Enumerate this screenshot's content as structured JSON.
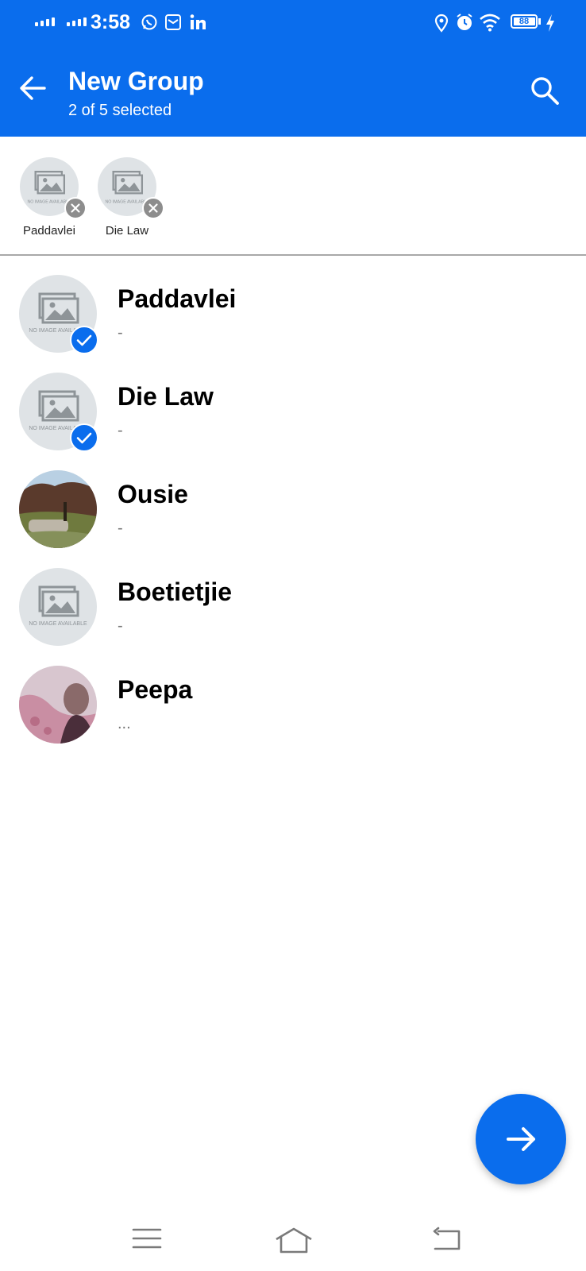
{
  "status_bar": {
    "time": "3:58",
    "battery": "88"
  },
  "header": {
    "title": "New Group",
    "subtitle": "2 of 5 selected"
  },
  "selected": [
    {
      "name": "Paddavlei"
    },
    {
      "name": "Die Law"
    }
  ],
  "contacts": [
    {
      "name": "Paddavlei",
      "status": "-",
      "selected": true
    },
    {
      "name": "Die Law",
      "status": "-",
      "selected": true
    },
    {
      "name": "Ousie",
      "status": "-",
      "selected": false
    },
    {
      "name": "Boetietjie",
      "status": "-",
      "selected": false
    },
    {
      "name": "Peepa",
      "status": "...",
      "selected": false
    }
  ],
  "placeholder_image_text": "NO IMAGE AVAILABLE",
  "colors": {
    "accent": "#0a6ded",
    "placeholder_bg": "#dfe3e6"
  }
}
